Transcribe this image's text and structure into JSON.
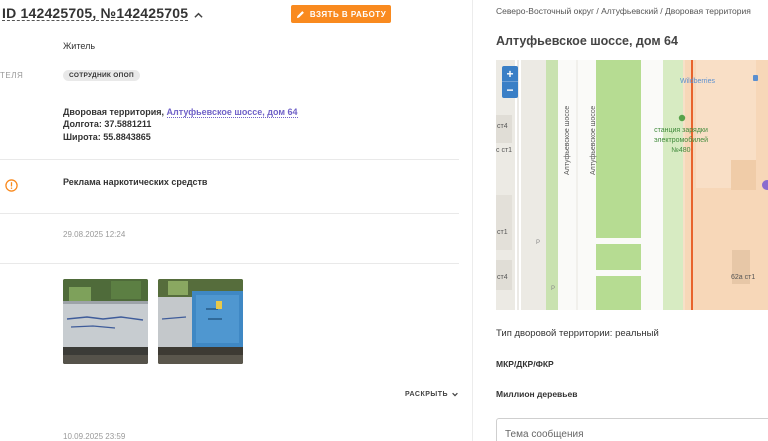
{
  "header": {
    "title": "ID 142425705, №142425705",
    "take_button": "ВЗЯТЬ В РАБОТУ"
  },
  "fields": {
    "author_value": "Житель",
    "executor_label": "ТЕЛЯ",
    "executor_badge": "СОТРУДНИК ОПОП",
    "location_prefix": "Дворовая территория, ",
    "location_link": "Алтуфьевское шоссе, дом 64",
    "longitude": "Долгота: 37.5881211",
    "latitude": "Широта: 55.8843865",
    "problem": "Реклама наркотических средств",
    "created": "29.08.2025 12:24",
    "expand": "РАСКРЫТЬ",
    "deadline": "10.09.2025 23:59"
  },
  "photos": [
    {
      "name": "photo-1"
    },
    {
      "name": "photo-2"
    }
  ],
  "right": {
    "breadcrumb": "Северо-Восточный округ / Алтуфьевский / Дворовая территория",
    "title": "Алтуфьевское шоссе, дом 64",
    "map": {
      "zoom_in": "+",
      "zoom_out": "−",
      "road_label_1": "Алтуфьевское шоссе",
      "road_label_2": "Алтуфьевское шоссе",
      "store_label": "Wildberries",
      "poi_line1": "станция зарядки",
      "poi_line2": "электромобилей",
      "poi_line3": "№480",
      "bldg_1": "ст4",
      "bldg_2": "с ст1",
      "bldg_3": "ст1",
      "bldg_4": "ст4",
      "bldg_5": "62а ст1",
      "parking_1": "P",
      "parking_2": "P"
    },
    "territory_type": "Тип дворовой территории: реальный",
    "mkr": "МКР/ДКР/ФКР",
    "million_trees": "Миллион деревьев",
    "message_placeholder": "Тема сообщения"
  },
  "colors": {
    "accent": "#f98a1f",
    "link": "#7062c8",
    "map_zoom": "#3a7fc6",
    "map_green": "#b6dc92",
    "map_red_line": "#e8632c"
  }
}
